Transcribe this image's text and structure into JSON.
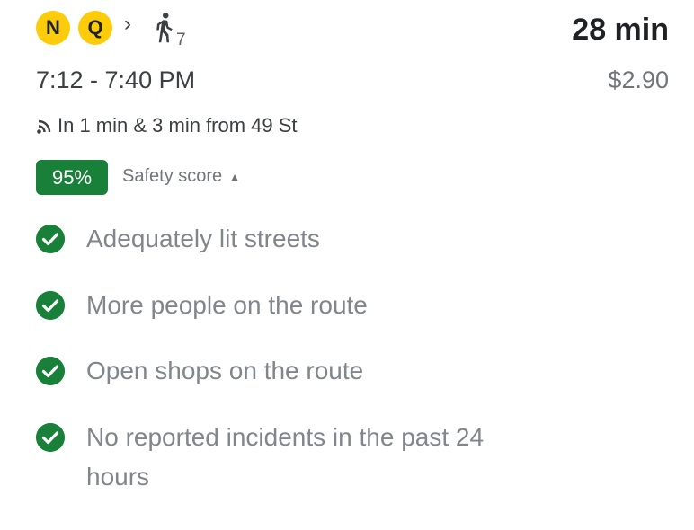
{
  "route": {
    "lines": [
      {
        "label": "N",
        "color": "#fccc0a"
      },
      {
        "label": "Q",
        "color": "#fccc0a"
      }
    ],
    "separator_icon": "chevron-right-icon",
    "walk": {
      "icon": "walking-person-icon",
      "minutes": "7"
    },
    "duration": "28 min",
    "time_range": "7:12 - 7:40 PM",
    "fare": "$2.90",
    "realtime": {
      "icon": "realtime-signal-icon",
      "text": "In 1 min & 3 min from 49 St"
    }
  },
  "safety": {
    "score": "95%",
    "label": "Safety score",
    "toggle_icon": "caret-up-icon",
    "accent_color": "#188038",
    "factors": [
      {
        "text": "Adequately lit streets"
      },
      {
        "text": "More people on the route"
      },
      {
        "text": "Open shops on the route"
      },
      {
        "text": "No reported incidents in the past 24 hours"
      }
    ]
  }
}
